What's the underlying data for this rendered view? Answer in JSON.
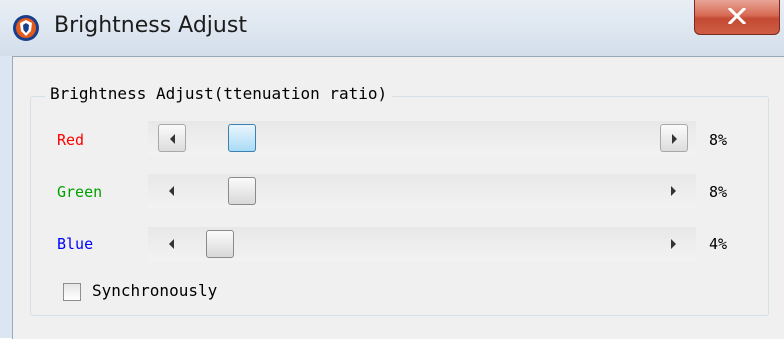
{
  "window": {
    "title": "Brightness Adjust"
  },
  "group": {
    "label": "Brightness Adjust(ttenuation ratio)"
  },
  "channels": [
    {
      "label": "Red",
      "value_text": "8%",
      "value_percent": 8,
      "color": "#ff0000"
    },
    {
      "label": "Green",
      "value_text": "8%",
      "value_percent": 8,
      "color": "#00a000"
    },
    {
      "label": "Blue",
      "value_text": "4%",
      "value_percent": 4,
      "color": "#0000ff"
    }
  ],
  "sync": {
    "label": "Synchronously",
    "checked": false
  },
  "icons": {
    "app": "shield-app-icon",
    "close": "close-icon",
    "left": "chevron-left-icon",
    "right": "chevron-right-icon"
  }
}
